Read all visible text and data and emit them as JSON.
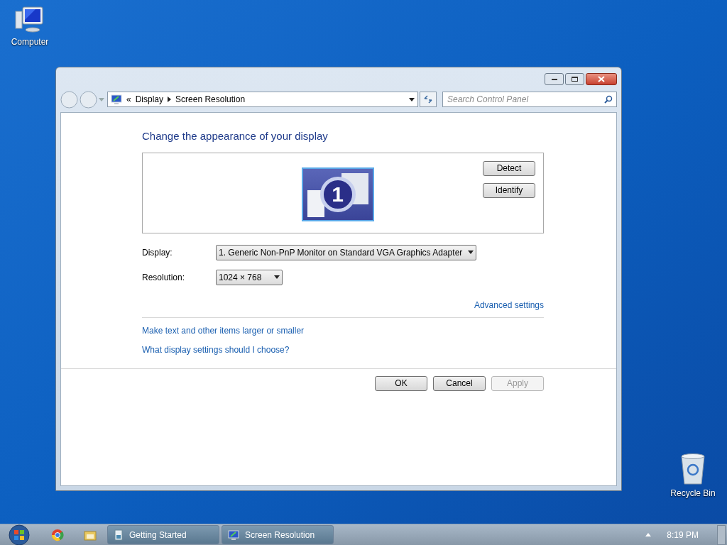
{
  "desktop_icons": [
    {
      "label": "Computer",
      "kind": "computer"
    },
    {
      "label": "Recycle Bin",
      "kind": "recycle-bin"
    }
  ],
  "window": {
    "address": {
      "overflow": "«",
      "breadcrumb": [
        "Display",
        "Screen Resolution"
      ]
    },
    "search": {
      "placeholder": "Search Control Panel"
    },
    "heading": "Change the appearance of your display",
    "monitor": {
      "number": "1"
    },
    "side_buttons": [
      "Detect",
      "Identify"
    ],
    "fields": [
      {
        "label": "Display:",
        "value": "1. Generic Non-PnP Monitor on Standard VGA Graphics Adapter"
      },
      {
        "label": "Resolution:",
        "value": "1024 × 768"
      }
    ],
    "advanced_link": "Advanced settings",
    "links": [
      "Make text and other items larger or smaller",
      "What display settings should I choose?"
    ],
    "buttons": [
      {
        "label": "OK",
        "disabled": false
      },
      {
        "label": "Cancel",
        "disabled": false
      },
      {
        "label": "Apply",
        "disabled": true
      }
    ]
  },
  "taskbar": {
    "buttons": [
      {
        "label": "Getting Started",
        "kind": "document"
      },
      {
        "label": "Screen Resolution",
        "kind": "display"
      }
    ],
    "clock": "8:19 PM"
  }
}
